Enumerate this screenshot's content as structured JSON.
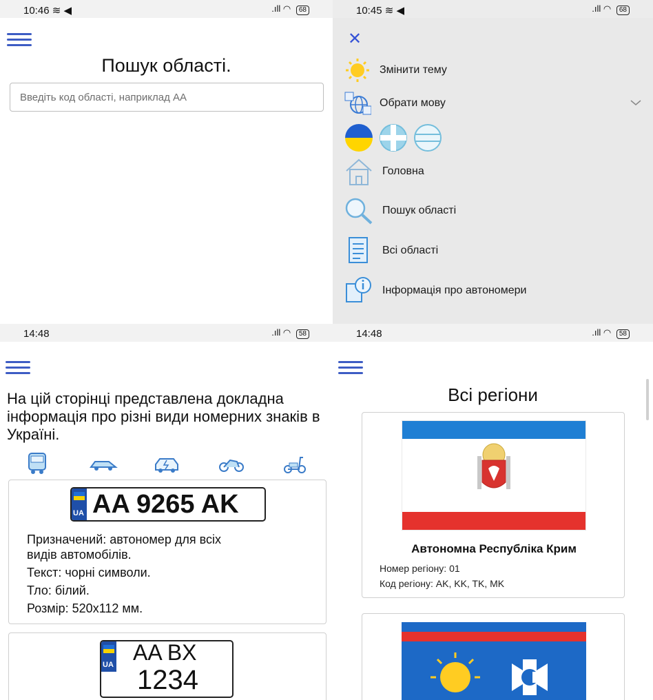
{
  "screen1": {
    "status": {
      "time": "10:46 ≋ ◀",
      "signal": ".ıll",
      "battery": "68"
    },
    "title": "Пошук області.",
    "search_placeholder": "Введіть код області, наприклад АА"
  },
  "screen2": {
    "status": {
      "time": "10:45 ≋ ◀",
      "signal": ".ıll",
      "battery": "68"
    },
    "close_icon": "✕",
    "menu": {
      "theme": "Змінити тему",
      "language": "Обрати мову",
      "home": "Головна",
      "search": "Пошук області",
      "all": "Всі області",
      "info": "Інформація про автономери"
    }
  },
  "screen3": {
    "status": {
      "time": "14:48",
      "signal": ".ıll",
      "battery": "58"
    },
    "intro": "На цій сторінці представлена докладна інформація про різні види номерних знаків в Україні.",
    "vehicles": [
      "bus-icon",
      "car-icon",
      "electric-car-icon",
      "motorcycle-icon",
      "scooter-icon"
    ],
    "plate1": {
      "country": "UA",
      "number": "AA 9265 AK",
      "lines": [
        "Призначений: автономер для всіх",
        "видів автомобілів.",
        "Текст: чорні символи.",
        "Тло: білий.",
        "Розмір: 520x112 мм."
      ]
    },
    "plate2": {
      "country": "UA",
      "top": "AA   BX",
      "bottom": "1234"
    }
  },
  "screen4": {
    "status": {
      "time": "14:48",
      "signal": ".ıll",
      "battery": "58"
    },
    "title": "Всі регіони",
    "regions": [
      {
        "name": "Автономна Республіка Крим",
        "number": "Номер регіону: 01",
        "codes": "Код регіону: AK, KK, TK, MK"
      }
    ]
  },
  "colors": {
    "accent": "#3d5cc4",
    "ua_blue": "#1f6fd6",
    "ua_yellow": "#f6d200",
    "crimea_red": "#e5322d",
    "crimea_blue": "#1f7fd4"
  }
}
